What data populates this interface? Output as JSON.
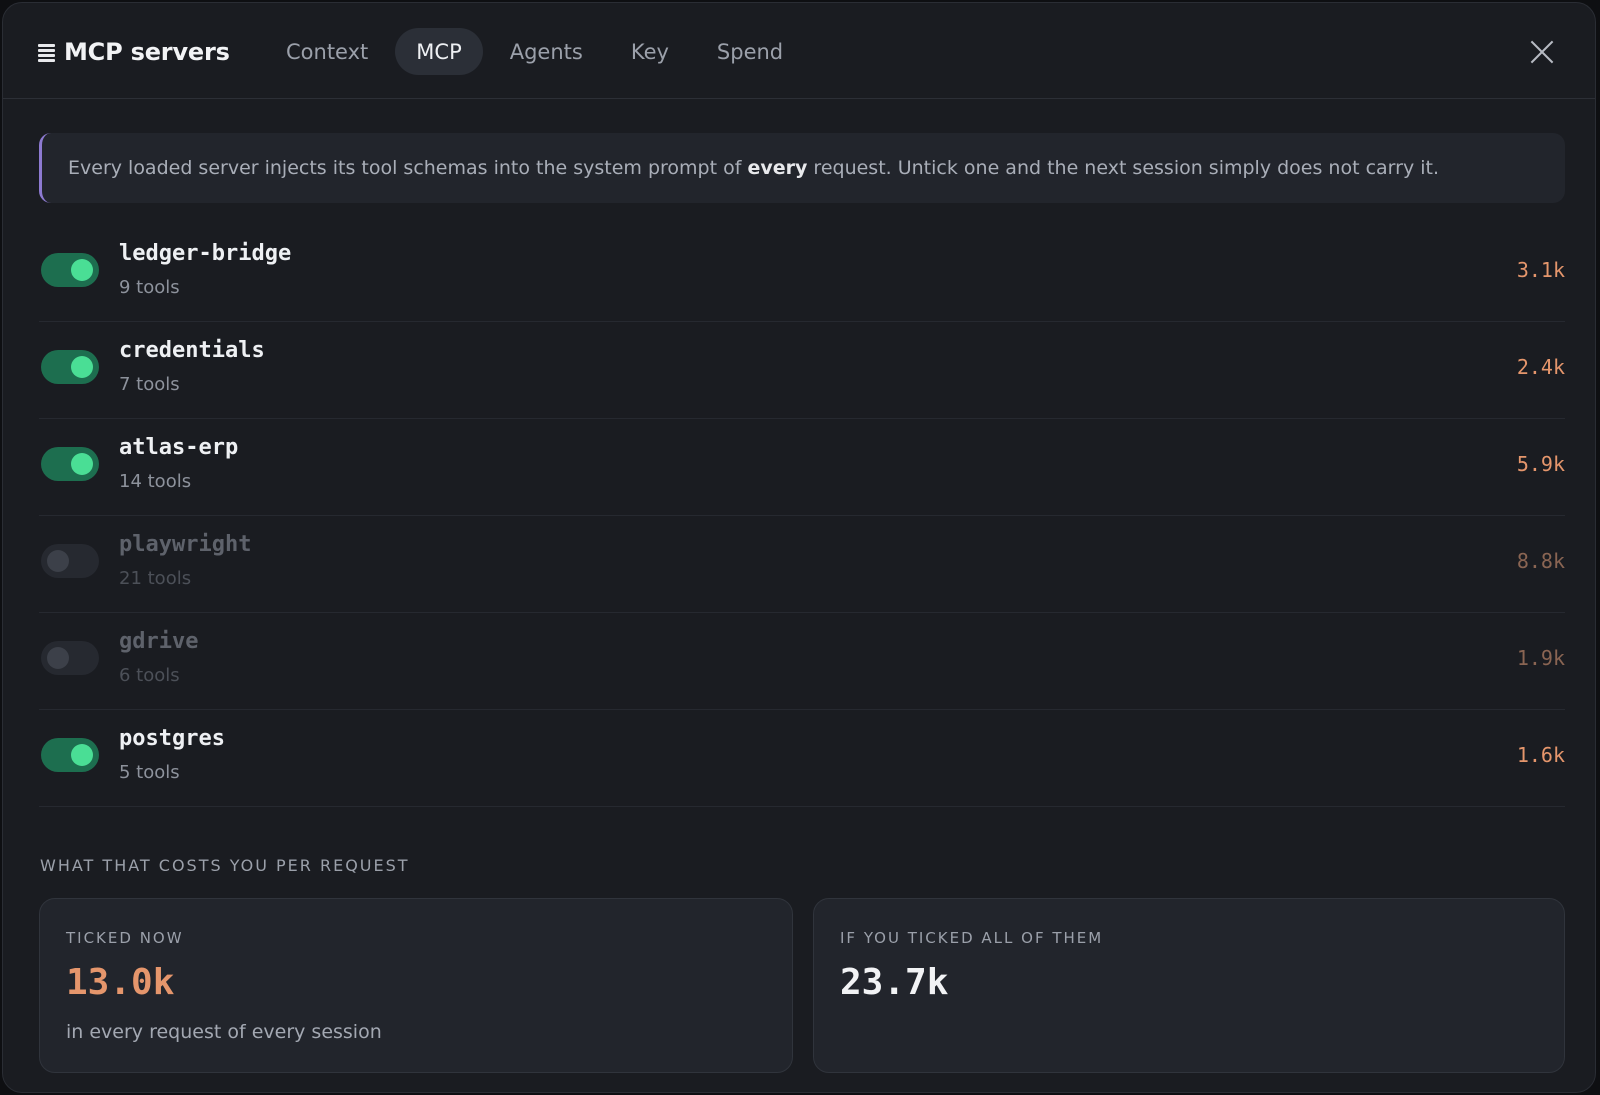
{
  "header": {
    "title": "MCP servers",
    "icon": "list-icon",
    "tabs": [
      {
        "label": "Context",
        "active": false
      },
      {
        "label": "MCP",
        "active": true
      },
      {
        "label": "Agents",
        "active": false
      },
      {
        "label": "Key",
        "active": false
      },
      {
        "label": "Spend",
        "active": false
      }
    ]
  },
  "banner": {
    "text_before": "Every loaded server injects its tool schemas into the system prompt of ",
    "emphasis": "every",
    "text_after": " request. Untick one and the next session simply does not carry it.",
    "accent_color": "#8d7ad1"
  },
  "servers": [
    {
      "name": "ledger-bridge",
      "tools": "9 tools",
      "cost": "3.1k",
      "enabled": true
    },
    {
      "name": "credentials",
      "tools": "7 tools",
      "cost": "2.4k",
      "enabled": true
    },
    {
      "name": "atlas-erp",
      "tools": "14 tools",
      "cost": "5.9k",
      "enabled": true
    },
    {
      "name": "playwright",
      "tools": "21 tools",
      "cost": "8.8k",
      "enabled": false
    },
    {
      "name": "gdrive",
      "tools": "6 tools",
      "cost": "1.9k",
      "enabled": false
    },
    {
      "name": "postgres",
      "tools": "5 tools",
      "cost": "1.6k",
      "enabled": true
    }
  ],
  "costs": {
    "section_label": "WHAT THAT COSTS YOU PER REQUEST",
    "ticked_now": {
      "label": "TICKED NOW",
      "value": "13.0k",
      "sub": "in every request of every session"
    },
    "all_ticked": {
      "label": "IF YOU TICKED ALL OF THEM",
      "value": "23.7k"
    }
  },
  "colors": {
    "toggle_on": "#1d6e4f",
    "toggle_knob_on": "#4ade95",
    "cost": "#e5966c"
  }
}
